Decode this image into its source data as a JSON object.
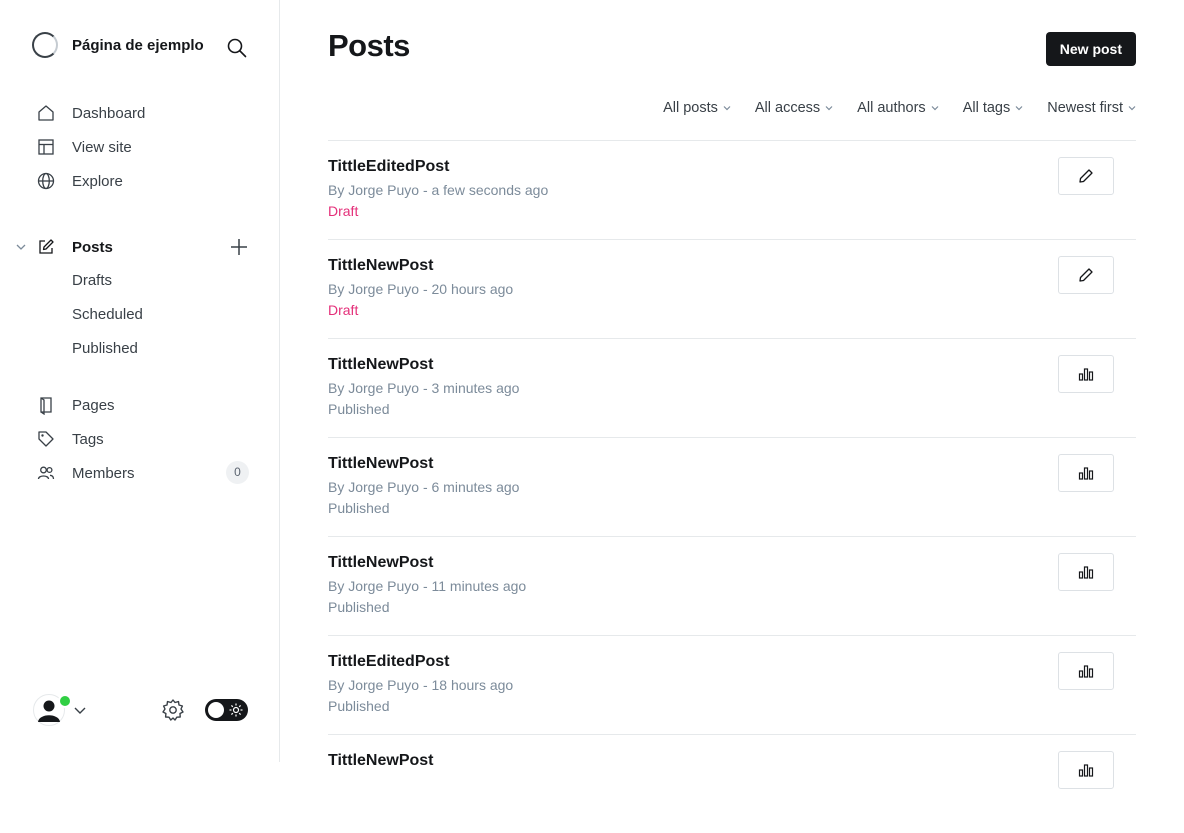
{
  "sidebar": {
    "site_name": "Página de ejemplo",
    "nav": [
      {
        "id": "dashboard",
        "label": "Dashboard",
        "icon": "house-icon"
      },
      {
        "id": "view-site",
        "label": "View site",
        "icon": "layout-icon"
      },
      {
        "id": "explore",
        "label": "Explore",
        "icon": "globe-icon"
      }
    ],
    "posts_label": "Posts",
    "post_subs": [
      "Drafts",
      "Scheduled",
      "Published"
    ],
    "nav2": [
      {
        "id": "pages",
        "label": "Pages",
        "icon": "page-icon"
      },
      {
        "id": "tags",
        "label": "Tags",
        "icon": "tag-icon"
      },
      {
        "id": "members",
        "label": "Members",
        "icon": "members-icon"
      }
    ],
    "members_count": "0"
  },
  "main": {
    "title": "Posts",
    "new_post_label": "New post",
    "filters": [
      "All posts",
      "All access",
      "All authors",
      "All tags",
      "Newest first"
    ],
    "posts": [
      {
        "title": "TittleEditedPost",
        "meta": "By Jorge Puyo - a few seconds ago",
        "status": "Draft",
        "action": "edit-icon"
      },
      {
        "title": "TittleNewPost",
        "meta": "By Jorge Puyo - 20 hours ago",
        "status": "Draft",
        "action": "edit-icon"
      },
      {
        "title": "TittleNewPost",
        "meta": "By Jorge Puyo - 3 minutes ago",
        "status": "Published",
        "action": "analytics-icon"
      },
      {
        "title": "TittleNewPost",
        "meta": "By Jorge Puyo - 6 minutes ago",
        "status": "Published",
        "action": "analytics-icon"
      },
      {
        "title": "TittleNewPost",
        "meta": "By Jorge Puyo - 11 minutes ago",
        "status": "Published",
        "action": "analytics-icon"
      },
      {
        "title": "TittleEditedPost",
        "meta": "By Jorge Puyo - 18 hours ago",
        "status": "Published",
        "action": "analytics-icon"
      },
      {
        "title": "TittleNewPost",
        "meta": "",
        "status": "",
        "action": "analytics-icon"
      }
    ]
  },
  "colors": {
    "draft": "#e42f79",
    "published": "#7c8b9a",
    "accent": "#15171a",
    "online": "#30cf43"
  }
}
